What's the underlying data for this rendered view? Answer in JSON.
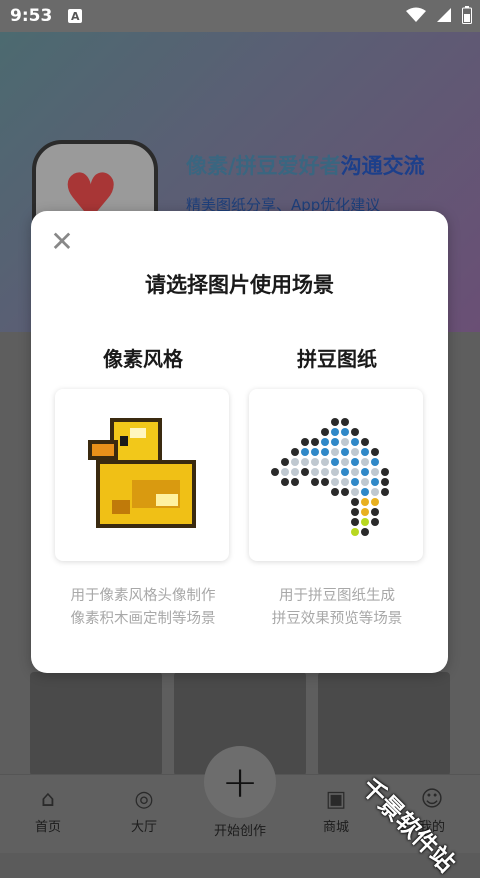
{
  "status_bar": {
    "time": "9:53",
    "notification_badge": "A"
  },
  "banner": {
    "title_main": "像素/拼豆爱好者",
    "title_accent": "沟通交流",
    "subtitle": "精美图纸分享、App优化建议"
  },
  "modal": {
    "title": "请选择图片使用场景",
    "options": [
      {
        "label": "像素风格",
        "desc_line1": "用于像素风格头像制作",
        "desc_line2": "像素积木画定制等场景"
      },
      {
        "label": "拼豆图纸",
        "desc_line1": "用于拼豆图纸生成",
        "desc_line2": "拼豆效果预览等场景"
      }
    ]
  },
  "tabbar": {
    "home": "首页",
    "hall": "大厅",
    "create": "开始创作",
    "mall": "商城",
    "mine": "我的"
  },
  "watermark": "千景软件站",
  "colors": {
    "accent_blue": "#1c3f8a",
    "heart_red": "#a83636",
    "duck_yellow": "#f2c81a",
    "fish_blue": "#2f88c8"
  }
}
